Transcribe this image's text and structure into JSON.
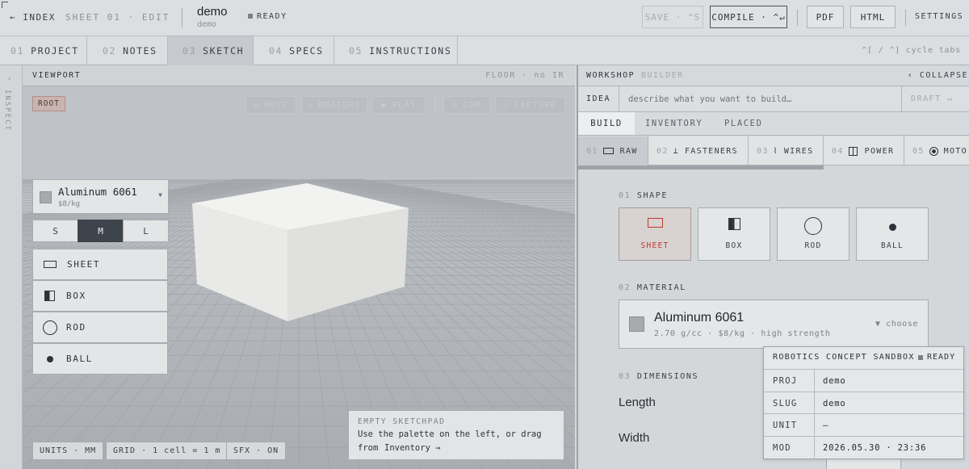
{
  "header": {
    "back_label": "← INDEX",
    "sheet_label": "SHEET 01 · EDIT",
    "doc_title": "demo",
    "doc_slug": "demo",
    "status": "READY",
    "save_label": "SAVE · ^S",
    "compile_label": "COMPILE · ^↵",
    "pdf_label": "PDF",
    "html_label": "HTML",
    "settings_label": "SETTINGS"
  },
  "tabs": [
    {
      "num": "01",
      "label": "PROJECT"
    },
    {
      "num": "02",
      "label": "NOTES"
    },
    {
      "num": "03",
      "label": "SKETCH"
    },
    {
      "num": "04",
      "label": "SPECS"
    },
    {
      "num": "05",
      "label": "INSTRUCTIONS"
    }
  ],
  "tabs_hint": "^[ / ^] cycle tabs",
  "rail_label": "INSPECT",
  "viewport": {
    "title": "VIEWPORT",
    "floor_info": "FLOOR · no IR",
    "root_badge": "ROOT",
    "tools": [
      "MOVE",
      "MEASURE",
      "PLAY",
      "COM",
      "CAPTURE"
    ],
    "material": {
      "name": "Aluminum 6061",
      "price": "$8/kg"
    },
    "sizes": [
      "S",
      "M",
      "L"
    ],
    "palette": [
      "SHEET",
      "BOX",
      "ROD",
      "BALL"
    ],
    "status_units": "UNITS · MM",
    "status_grid": "GRID · 1 cell = 1 m",
    "status_sfx": "SFX · ON",
    "empty_title": "EMPTY SKETCHPAD",
    "empty_text": "Use the palette on the left, or drag",
    "empty_text2": "from",
    "empty_link": "Inventory →"
  },
  "workshop": {
    "title": "WORKSHOP",
    "subtitle": "BUILDER",
    "collapse_label": "‹ COLLAPSE",
    "idea_label": "IDEA",
    "idea_placeholder": "describe what you want to build…",
    "draft_label": "DRAFT ↵",
    "subtabs": [
      "BUILD",
      "INVENTORY",
      "PLACED"
    ],
    "categories": [
      {
        "num": "01",
        "label": "RAW"
      },
      {
        "num": "02",
        "label": "FASTENERS"
      },
      {
        "num": "03",
        "label": "WIRES"
      },
      {
        "num": "04",
        "label": "POWER"
      },
      {
        "num": "05",
        "label": "MOTO"
      }
    ],
    "shape_section": {
      "num": "01",
      "label": "SHAPE"
    },
    "shapes": [
      "SHEET",
      "BOX",
      "ROD",
      "BALL"
    ],
    "material_section": {
      "num": "02",
      "label": "MATERIAL"
    },
    "material": {
      "name": "Aluminum 6061",
      "details": "2.70 g/cc · $8/kg · high strength",
      "choose": "▼ choose"
    },
    "dimensions_section": {
      "num": "03",
      "label": "DIMENSIONS"
    },
    "dimensions": [
      "Length",
      "Width"
    ]
  },
  "card": {
    "title": "ROBOTICS CONCEPT SANDBOX",
    "status": "READY",
    "rows": [
      {
        "key": "PROJ",
        "value": "demo"
      },
      {
        "key": "SLUG",
        "value": "demo"
      },
      {
        "key": "UNIT",
        "value": "—"
      },
      {
        "key": "MOD",
        "value": "2026.05.30 · 23:36"
      }
    ]
  },
  "colors": {
    "accent_red": "#c0392b",
    "active_dark": "#3d444c"
  }
}
